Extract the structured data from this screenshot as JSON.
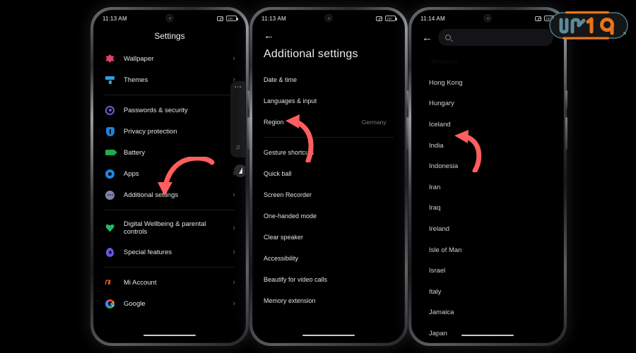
{
  "accent": {
    "arrow_red": "#FF5E5E",
    "logo_orange": "#E8741C",
    "logo_blue": "#4E7E8E",
    "screen_bg": "#000000"
  },
  "logo": {
    "name": "site-watermark",
    "text": "UR19"
  },
  "phones": [
    {
      "id": "phone-settings",
      "statusbar": {
        "time": "11:13 AM",
        "battery_text": "100"
      },
      "title": "Settings",
      "groups": [
        {
          "items": [
            {
              "label": "Wallpaper",
              "icon": "flower-icon",
              "icon_class": "i-flower"
            },
            {
              "label": "Themes",
              "icon": "theme-brush-icon",
              "icon_class": "i-theme"
            }
          ]
        },
        {
          "items": [
            {
              "label": "Passwords & security",
              "icon": "fingerprint-icon",
              "icon_class": "i-ring"
            },
            {
              "label": "Privacy protection",
              "icon": "shield-icon",
              "icon_class": "i-shield"
            },
            {
              "label": "Battery",
              "icon": "battery-icon",
              "icon_class": "i-batt"
            },
            {
              "label": "Apps",
              "icon": "gear-icon",
              "icon_class": "i-gear"
            },
            {
              "label": "Additional settings",
              "icon": "more-dots-icon",
              "icon_class": "i-dots"
            }
          ]
        },
        {
          "items": [
            {
              "label": "Digital Wellbeing & parental controls",
              "icon": "heart-icon",
              "icon_class": "i-heart",
              "two_line": true
            },
            {
              "label": "Special features",
              "icon": "special-features-icon",
              "icon_class": "i-special"
            }
          ]
        },
        {
          "items": [
            {
              "label": "Mi Account",
              "icon": "mi-logo-icon",
              "icon_class": "i-mi"
            },
            {
              "label": "Google",
              "icon": "google-logo-icon",
              "icon_class": "i-google"
            }
          ]
        }
      ],
      "sidepanel": {
        "name": "floating-side-panel",
        "music_glyph": "♫"
      }
    },
    {
      "id": "phone-additional-settings",
      "statusbar": {
        "time": "11:13 AM",
        "battery_text": "100"
      },
      "back_glyph": "←",
      "title": "Additional settings",
      "items": [
        {
          "label": "Date & time",
          "value": ""
        },
        {
          "label": "Languages & input",
          "value": ""
        },
        {
          "label": "Region",
          "value": "Germany",
          "divider_after": true
        },
        {
          "label": "Gesture shortcuts",
          "value": ""
        },
        {
          "label": "Quick ball",
          "value": ""
        },
        {
          "label": "Screen Recorder",
          "value": ""
        },
        {
          "label": "One-handed mode",
          "value": ""
        },
        {
          "label": "Clear speaker",
          "value": ""
        },
        {
          "label": "Accessibility",
          "value": ""
        },
        {
          "label": "Beautify for video calls",
          "value": ""
        },
        {
          "label": "Memory extension",
          "value": ""
        }
      ]
    },
    {
      "id": "phone-region-list",
      "statusbar": {
        "time": "11:14 AM",
        "battery_text": "100"
      },
      "back_glyph": "←",
      "search": {
        "placeholder": "",
        "value": "",
        "icon": "search-icon"
      },
      "countries": [
        {
          "label": "Honduras",
          "clipped": true
        },
        {
          "label": "Hong Kong"
        },
        {
          "label": "Hungary"
        },
        {
          "label": "Iceland"
        },
        {
          "label": "India"
        },
        {
          "label": "Indonesia"
        },
        {
          "label": "Iran"
        },
        {
          "label": "Iraq"
        },
        {
          "label": "Ireland"
        },
        {
          "label": "Isle of Man"
        },
        {
          "label": "Israel"
        },
        {
          "label": "Italy"
        },
        {
          "label": "Jamaica"
        },
        {
          "label": "Japan"
        }
      ]
    }
  ],
  "annotations": [
    {
      "name": "arrow-to-additional-settings",
      "target": "Additional settings"
    },
    {
      "name": "arrow-to-region",
      "target": "Region"
    },
    {
      "name": "arrow-to-india",
      "target": "India"
    }
  ]
}
